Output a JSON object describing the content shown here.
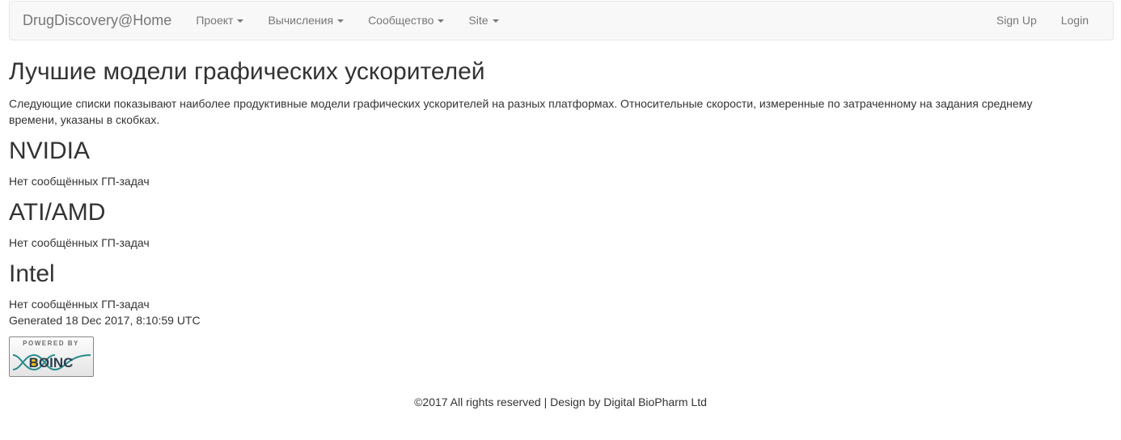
{
  "navbar": {
    "brand": "DrugDiscovery@Home",
    "left_items": [
      {
        "label": "Проект"
      },
      {
        "label": "Вычисления"
      },
      {
        "label": "Сообщество"
      },
      {
        "label": "Site"
      }
    ],
    "right_items": [
      {
        "label": "Sign Up"
      },
      {
        "label": "Login"
      }
    ]
  },
  "main": {
    "title": "Лучшие модели графических ускорителей",
    "intro": "Следующие списки показывают наиболее продуктивные модели графических ускорителей на разных платформах. Относительные скорости, измеренные по затраченному на задания среднему времени, указаны в скобках.",
    "sections": [
      {
        "heading": "NVIDIA",
        "text": "Нет сообщённых ГП-задач"
      },
      {
        "heading": "ATI/AMD",
        "text": "Нет сообщённых ГП-задач"
      },
      {
        "heading": "Intel",
        "text": "Нет сообщённых ГП-задач"
      }
    ],
    "generated": "Generated 18 Dec 2017, 8:10:59 UTC"
  },
  "logo": {
    "top_text": "POWERED BY",
    "brand_text": "BOINC"
  },
  "footer": {
    "text": "©2017 All rights reserved | Design by Digital BioPharm Ltd"
  }
}
